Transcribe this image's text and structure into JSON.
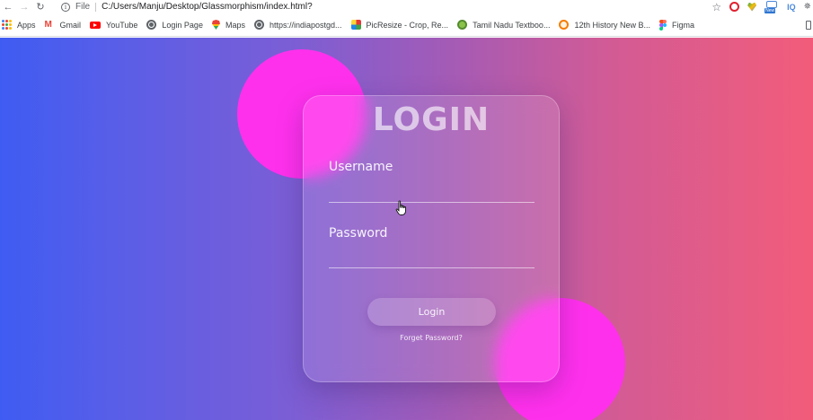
{
  "browser": {
    "scheme_label": "File",
    "url": "C:/Users/Manju/Desktop/Glassmorphism/index.html?",
    "extensions": [
      "opera-icon",
      "heart-extension-icon",
      "new-extension-icon",
      "iq-extension-icon",
      "puzzle-extension-icon"
    ],
    "new_badge": "New",
    "iq_label": "IQ",
    "bookmarks": [
      {
        "label": "Apps",
        "icon": "apps-icon"
      },
      {
        "label": "Gmail",
        "icon": "gmail-icon"
      },
      {
        "label": "YouTube",
        "icon": "youtube-icon"
      },
      {
        "label": "Login Page",
        "icon": "globe-icon"
      },
      {
        "label": "Maps",
        "icon": "maps-icon"
      },
      {
        "label": "https://indiapostgd...",
        "icon": "globe-icon"
      },
      {
        "label": "PicResize - Crop, Re...",
        "icon": "picresize-icon"
      },
      {
        "label": "Tamil Nadu Textboo...",
        "icon": "tamilnadu-icon"
      },
      {
        "label": "12th History New B...",
        "icon": "history-icon"
      },
      {
        "label": "Figma",
        "icon": "figma-icon"
      }
    ]
  },
  "login": {
    "title": "LOGIN",
    "username_label": "Username",
    "username_value": "",
    "password_label": "Password",
    "password_value": "",
    "button_label": "Login",
    "forgot_label": "Forget Password?"
  },
  "colors": {
    "gradient_left": "#3f5cf2",
    "gradient_right": "#f25c7a",
    "circle": "#ff30ec"
  }
}
